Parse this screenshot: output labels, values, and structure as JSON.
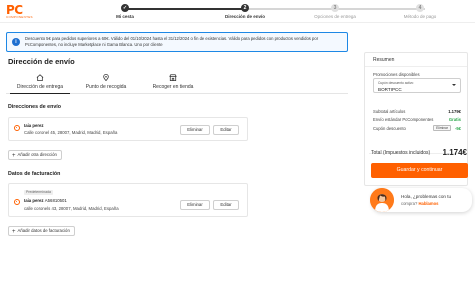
{
  "brand": {
    "logo_text": "PC",
    "logo_subtext": "COMPONENTES",
    "accent_color": "#ff6000"
  },
  "stepper": {
    "steps": [
      {
        "number": "✓",
        "label": "Mi cesta",
        "state": "done"
      },
      {
        "number": "2",
        "label": "Dirección de envío",
        "state": "active"
      },
      {
        "number": "3",
        "label": "Opciones de entrega",
        "state": "todo"
      },
      {
        "number": "4",
        "label": "Método de pago",
        "state": "todo"
      }
    ]
  },
  "banner": {
    "icon": "info-icon",
    "text": "Descuento 5€ para pedidos superiores a 60€. Válido del 01/10/2024 hasta el 31/12/2024 o fin de existencias. Válido para pedidos con productos vendidos por PcComponentes, no incluye Marketplace ni Gama Blanca. Uno por cliente"
  },
  "page_title": "Dirección de envío",
  "tabs": [
    {
      "label": "Dirección de entrega",
      "icon": "home-icon",
      "active": true
    },
    {
      "label": "Punto de recogida",
      "icon": "location-pin-icon",
      "active": false
    },
    {
      "label": "Recoger en tienda",
      "icon": "store-icon",
      "active": false
    }
  ],
  "shipping": {
    "section_title": "Direcciones de envío",
    "address": {
      "name": "Iaia perez",
      "line": "Calle coronel 45, 28007, Madrid, Madrid, España"
    },
    "delete_label": "Eliminar",
    "edit_label": "Editar",
    "add_label": "Añadir otra dirección"
  },
  "billing": {
    "section_title": "Datos de facturación",
    "badge": "Predeterminada",
    "address": {
      "name": "Iaia perez",
      "nif": "A56810501",
      "line": "calle coronels 43, 28007, Madrid, Madrid, España"
    },
    "delete_label": "Eliminar",
    "edit_label": "Editar",
    "add_label": "Añadir datos de facturación"
  },
  "summary": {
    "title": "Resumen",
    "promos_label": "Promociones disponibles",
    "coupon_label": "Cupón descuento activo",
    "coupon_value": "BORTIPCC",
    "rows": [
      {
        "label": "Subtotal artículos",
        "value": "1.179€",
        "style": "normal"
      },
      {
        "label": "Envío estándar PcComponentes",
        "value": "Gratis",
        "style": "green"
      },
      {
        "label": "Cupón descuento",
        "value": "-5€",
        "chip": "Eliminar",
        "style": "green"
      }
    ],
    "total_label": "Total (Impuestos incluidos)",
    "total_value": "1.174€",
    "cta_label": "Guardar y continuar"
  },
  "chat": {
    "line1": "Hola, ¿problemas con tu",
    "line2_prefix": "compra?",
    "line2_link": "Hablamos"
  }
}
